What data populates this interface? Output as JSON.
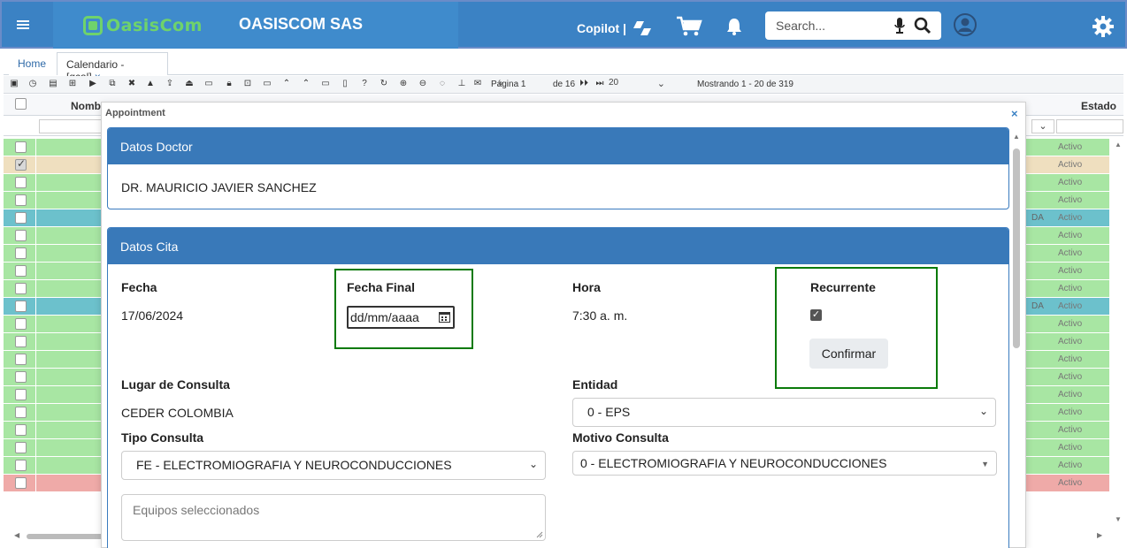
{
  "header": {
    "logo_text": "OasisCom",
    "company": "OASISCOM SAS",
    "copilot_label": "Copilot |",
    "search_placeholder": "Search..."
  },
  "tabs": [
    {
      "label": "Home"
    },
    {
      "label": "Calendario -[gcal]",
      "close": "×"
    }
  ],
  "toolbar": {
    "page_label": "Página 1",
    "page_of": "de 16",
    "page_size": "20",
    "showing": "Mostrando 1 - 20 de 319"
  },
  "grid": {
    "columns": {
      "name": "Nombre",
      "estado": "Estado"
    },
    "rows": [
      {
        "color": "#a8e6a3",
        "estado": "Activo",
        "checked": false,
        "extra": ""
      },
      {
        "color": "#efdfbf",
        "estado": "Activo",
        "checked": true,
        "extra": ""
      },
      {
        "color": "#a8e6a3",
        "estado": "Activo",
        "checked": false,
        "extra": ""
      },
      {
        "color": "#a8e6a3",
        "estado": "Activo",
        "checked": false,
        "extra": ""
      },
      {
        "color": "#6cc1cc",
        "estado": "Activo",
        "checked": false,
        "extra": "DA"
      },
      {
        "color": "#a8e6a3",
        "estado": "Activo",
        "checked": false,
        "extra": ""
      },
      {
        "color": "#a8e6a3",
        "estado": "Activo",
        "checked": false,
        "extra": ""
      },
      {
        "color": "#a8e6a3",
        "estado": "Activo",
        "checked": false,
        "extra": ""
      },
      {
        "color": "#a8e6a3",
        "estado": "Activo",
        "checked": false,
        "extra": ""
      },
      {
        "color": "#6cc1cc",
        "estado": "Activo",
        "checked": false,
        "extra": "DA"
      },
      {
        "color": "#a8e6a3",
        "estado": "Activo",
        "checked": false,
        "extra": ""
      },
      {
        "color": "#a8e6a3",
        "estado": "Activo",
        "checked": false,
        "extra": ""
      },
      {
        "color": "#a8e6a3",
        "estado": "Activo",
        "checked": false,
        "extra": ""
      },
      {
        "color": "#a8e6a3",
        "estado": "Activo",
        "checked": false,
        "extra": ""
      },
      {
        "color": "#a8e6a3",
        "estado": "Activo",
        "checked": false,
        "extra": ""
      },
      {
        "color": "#a8e6a3",
        "estado": "Activo",
        "checked": false,
        "extra": ""
      },
      {
        "color": "#a8e6a3",
        "estado": "Activo",
        "checked": false,
        "extra": ""
      },
      {
        "color": "#a8e6a3",
        "estado": "Activo",
        "checked": false,
        "extra": ""
      },
      {
        "color": "#a8e6a3",
        "estado": "Activo",
        "checked": false,
        "extra": ""
      },
      {
        "color": "#efaaa8",
        "estado": "Activo",
        "checked": false,
        "extra": ""
      }
    ]
  },
  "modal": {
    "title": "Appointment",
    "close": "×",
    "doctor": {
      "heading": "Datos Doctor",
      "name": "DR. MAURICIO JAVIER SANCHEZ"
    },
    "cita": {
      "heading": "Datos Cita",
      "fecha_label": "Fecha",
      "fecha_value": "17/06/2024",
      "fecha_final_label": "Fecha Final",
      "fecha_final_placeholder": "dd/mm/aaaa",
      "hora_label": "Hora",
      "hora_value": "7:30 a. m.",
      "recurrente_label": "Recurrente",
      "recurrente_checked": true,
      "confirmar_label": "Confirmar",
      "lugar_label": "Lugar de Consulta",
      "lugar_value": "CEDER COLOMBIA",
      "entidad_label": "Entidad",
      "entidad_value": "0 - EPS",
      "tipo_label": "Tipo Consulta",
      "tipo_value": "FE - ELECTROMIOGRAFIA Y NEUROCONDUCCIONES",
      "motivo_label": "Motivo Consulta",
      "motivo_value": "0 - ELECTROMIOGRAFIA Y NEUROCONDUCCIONES",
      "equipos_placeholder": "Equipos seleccionados"
    }
  },
  "colors": {
    "header_blue": "#3b82c4",
    "panel_blue": "#3979b9",
    "highlight_green": "#0a7a0a",
    "logo_green": "#6fd36b"
  }
}
